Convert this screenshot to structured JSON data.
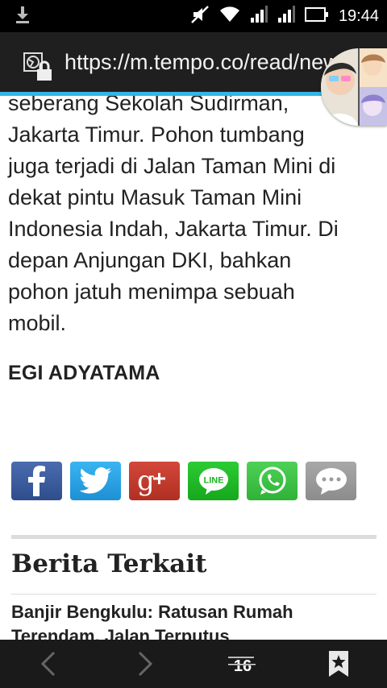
{
  "status_bar": {
    "time": "19:44",
    "icons": [
      "download-icon",
      "mute-icon",
      "wifi-icon",
      "signal-icon",
      "signal-icon-2",
      "battery-icon"
    ]
  },
  "browser": {
    "url": "https://m.tempo.co/read/news/",
    "progress_color": "#33b5e5"
  },
  "article": {
    "lines": [
      "seberang Sekolah Sudirman,",
      "Jakarta Timur. Pohon tumbang",
      "juga terjadi di Jalan Taman Mini di",
      "dekat pintu Masuk Taman Mini",
      "Indonesia Indah, Jakarta Timur. Di",
      "depan Anjungan DKI, bahkan",
      "pohon jatuh menimpa sebuah",
      "mobil."
    ],
    "author": "EGI ADYATAMA"
  },
  "share_buttons": [
    {
      "name": "facebook",
      "color": "#3b5998"
    },
    {
      "name": "twitter",
      "color": "#2aa3e8"
    },
    {
      "name": "google-plus",
      "color": "#c33a2b"
    },
    {
      "name": "line",
      "color": "#19b720",
      "label": "LINE"
    },
    {
      "name": "whatsapp",
      "color": "#3fc447"
    },
    {
      "name": "sms",
      "color": "#9b9b9b"
    }
  ],
  "related": {
    "title": "Berita Terkait",
    "items": [
      "Banjir Bengkulu: Ratusan Rumah Terendam, Jalan Terputus"
    ]
  },
  "bottom_nav": {
    "tabs_count": "16"
  }
}
